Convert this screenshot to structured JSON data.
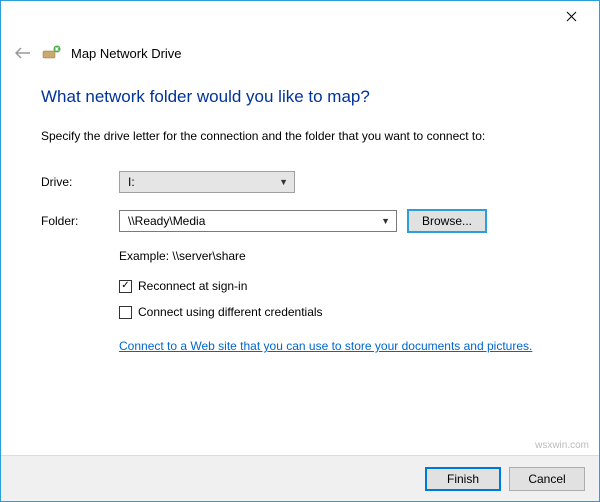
{
  "window": {
    "title": "Map Network Drive"
  },
  "heading": "What network folder would you like to map?",
  "subhead": "Specify the drive letter for the connection and the folder that you want to connect to:",
  "labels": {
    "drive": "Drive:",
    "folder": "Folder:",
    "example": "Example: \\\\server\\share",
    "reconnect": "Reconnect at sign-in",
    "credentials": "Connect using different credentials"
  },
  "values": {
    "drive": "I:",
    "folder": "\\\\Ready\\Media"
  },
  "buttons": {
    "browse": "Browse...",
    "finish": "Finish",
    "cancel": "Cancel"
  },
  "link": "Connect to a Web site that you can use to store your documents and pictures.",
  "checks": {
    "reconnect": "✓",
    "credentials": ""
  },
  "watermark": "wsxwin.com"
}
